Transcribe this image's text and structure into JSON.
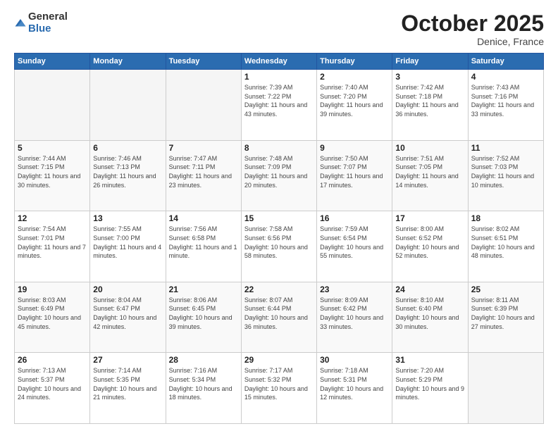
{
  "header": {
    "logo_general": "General",
    "logo_blue": "Blue",
    "month_title": "October 2025",
    "location": "Denice, France"
  },
  "days_of_week": [
    "Sunday",
    "Monday",
    "Tuesday",
    "Wednesday",
    "Thursday",
    "Friday",
    "Saturday"
  ],
  "weeks": [
    [
      {
        "day": "",
        "info": ""
      },
      {
        "day": "",
        "info": ""
      },
      {
        "day": "",
        "info": ""
      },
      {
        "day": "1",
        "info": "Sunrise: 7:39 AM\nSunset: 7:22 PM\nDaylight: 11 hours and 43 minutes."
      },
      {
        "day": "2",
        "info": "Sunrise: 7:40 AM\nSunset: 7:20 PM\nDaylight: 11 hours and 39 minutes."
      },
      {
        "day": "3",
        "info": "Sunrise: 7:42 AM\nSunset: 7:18 PM\nDaylight: 11 hours and 36 minutes."
      },
      {
        "day": "4",
        "info": "Sunrise: 7:43 AM\nSunset: 7:16 PM\nDaylight: 11 hours and 33 minutes."
      }
    ],
    [
      {
        "day": "5",
        "info": "Sunrise: 7:44 AM\nSunset: 7:15 PM\nDaylight: 11 hours and 30 minutes."
      },
      {
        "day": "6",
        "info": "Sunrise: 7:46 AM\nSunset: 7:13 PM\nDaylight: 11 hours and 26 minutes."
      },
      {
        "day": "7",
        "info": "Sunrise: 7:47 AM\nSunset: 7:11 PM\nDaylight: 11 hours and 23 minutes."
      },
      {
        "day": "8",
        "info": "Sunrise: 7:48 AM\nSunset: 7:09 PM\nDaylight: 11 hours and 20 minutes."
      },
      {
        "day": "9",
        "info": "Sunrise: 7:50 AM\nSunset: 7:07 PM\nDaylight: 11 hours and 17 minutes."
      },
      {
        "day": "10",
        "info": "Sunrise: 7:51 AM\nSunset: 7:05 PM\nDaylight: 11 hours and 14 minutes."
      },
      {
        "day": "11",
        "info": "Sunrise: 7:52 AM\nSunset: 7:03 PM\nDaylight: 11 hours and 10 minutes."
      }
    ],
    [
      {
        "day": "12",
        "info": "Sunrise: 7:54 AM\nSunset: 7:01 PM\nDaylight: 11 hours and 7 minutes."
      },
      {
        "day": "13",
        "info": "Sunrise: 7:55 AM\nSunset: 7:00 PM\nDaylight: 11 hours and 4 minutes."
      },
      {
        "day": "14",
        "info": "Sunrise: 7:56 AM\nSunset: 6:58 PM\nDaylight: 11 hours and 1 minute."
      },
      {
        "day": "15",
        "info": "Sunrise: 7:58 AM\nSunset: 6:56 PM\nDaylight: 10 hours and 58 minutes."
      },
      {
        "day": "16",
        "info": "Sunrise: 7:59 AM\nSunset: 6:54 PM\nDaylight: 10 hours and 55 minutes."
      },
      {
        "day": "17",
        "info": "Sunrise: 8:00 AM\nSunset: 6:52 PM\nDaylight: 10 hours and 52 minutes."
      },
      {
        "day": "18",
        "info": "Sunrise: 8:02 AM\nSunset: 6:51 PM\nDaylight: 10 hours and 48 minutes."
      }
    ],
    [
      {
        "day": "19",
        "info": "Sunrise: 8:03 AM\nSunset: 6:49 PM\nDaylight: 10 hours and 45 minutes."
      },
      {
        "day": "20",
        "info": "Sunrise: 8:04 AM\nSunset: 6:47 PM\nDaylight: 10 hours and 42 minutes."
      },
      {
        "day": "21",
        "info": "Sunrise: 8:06 AM\nSunset: 6:45 PM\nDaylight: 10 hours and 39 minutes."
      },
      {
        "day": "22",
        "info": "Sunrise: 8:07 AM\nSunset: 6:44 PM\nDaylight: 10 hours and 36 minutes."
      },
      {
        "day": "23",
        "info": "Sunrise: 8:09 AM\nSunset: 6:42 PM\nDaylight: 10 hours and 33 minutes."
      },
      {
        "day": "24",
        "info": "Sunrise: 8:10 AM\nSunset: 6:40 PM\nDaylight: 10 hours and 30 minutes."
      },
      {
        "day": "25",
        "info": "Sunrise: 8:11 AM\nSunset: 6:39 PM\nDaylight: 10 hours and 27 minutes."
      }
    ],
    [
      {
        "day": "26",
        "info": "Sunrise: 7:13 AM\nSunset: 5:37 PM\nDaylight: 10 hours and 24 minutes."
      },
      {
        "day": "27",
        "info": "Sunrise: 7:14 AM\nSunset: 5:35 PM\nDaylight: 10 hours and 21 minutes."
      },
      {
        "day": "28",
        "info": "Sunrise: 7:16 AM\nSunset: 5:34 PM\nDaylight: 10 hours and 18 minutes."
      },
      {
        "day": "29",
        "info": "Sunrise: 7:17 AM\nSunset: 5:32 PM\nDaylight: 10 hours and 15 minutes."
      },
      {
        "day": "30",
        "info": "Sunrise: 7:18 AM\nSunset: 5:31 PM\nDaylight: 10 hours and 12 minutes."
      },
      {
        "day": "31",
        "info": "Sunrise: 7:20 AM\nSunset: 5:29 PM\nDaylight: 10 hours and 9 minutes."
      },
      {
        "day": "",
        "info": ""
      }
    ]
  ]
}
